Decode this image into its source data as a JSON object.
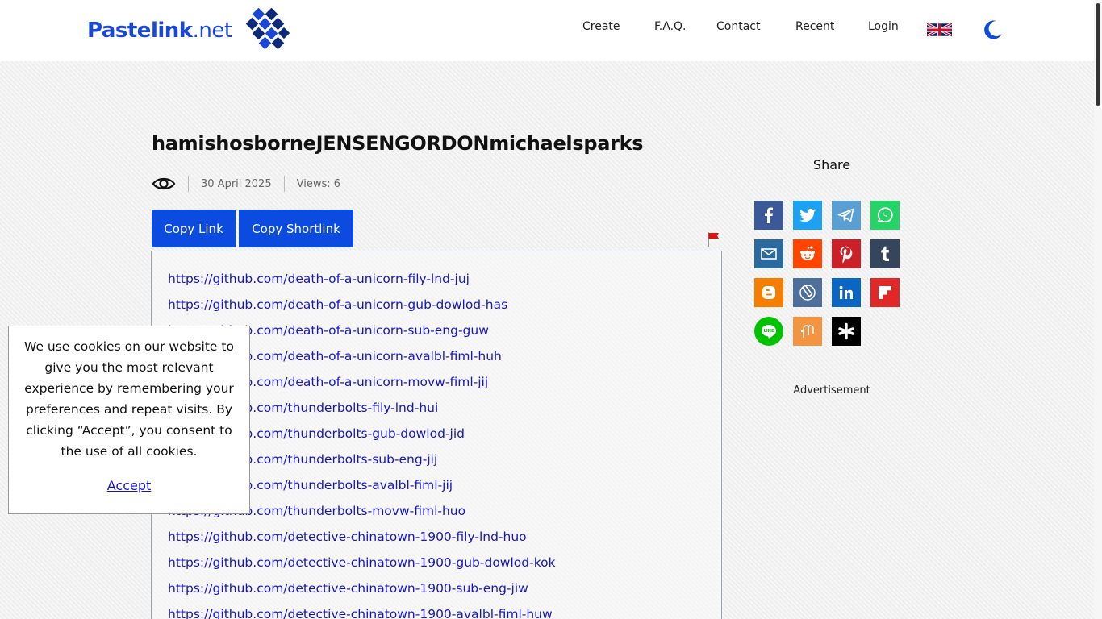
{
  "header": {
    "logo_text_main": "Pastelink",
    "logo_text_suffix": ".net",
    "nav": [
      {
        "label": "Create"
      },
      {
        "label": "F.A.Q."
      },
      {
        "label": "Contact"
      },
      {
        "label": "Recent"
      },
      {
        "label": "Login"
      }
    ],
    "language_icon": "uk-flag-icon",
    "theme_icon": "moon-icon",
    "brand_color": "#1a47d6"
  },
  "paste": {
    "title": "hamishosborneJENSENGORDONmichaelsparks",
    "visibility_icon": "eye-icon",
    "date": "30 April 2025",
    "views": "Views: 6",
    "copy_link_label": "Copy Link",
    "copy_shortlink_label": "Copy Shortlink",
    "report_icon": "red-flag-icon",
    "links": [
      "https://github.com/death-of-a-unicorn-fily-lnd-juj",
      "https://github.com/death-of-a-unicorn-gub-dowlod-has",
      "https://github.com/death-of-a-unicorn-sub-eng-guw",
      "https://github.com/death-of-a-unicorn-avalbl-fiml-huh",
      "https://github.com/death-of-a-unicorn-movw-fiml-jij",
      "https://github.com/thunderbolts-fily-lnd-hui",
      "https://github.com/thunderbolts-gub-dowlod-jid",
      "https://github.com/thunderbolts-sub-eng-jij",
      "https://github.com/thunderbolts-avalbl-fiml-jij",
      "https://github.com/thunderbolts-movw-fiml-huo",
      "https://github.com/detective-chinatown-1900-fily-lnd-huo",
      "https://github.com/detective-chinatown-1900-gub-dowlod-kok",
      "https://github.com/detective-chinatown-1900-sub-eng-jiw",
      "https://github.com/detective-chinatown-1900-avalbl-fiml-huw"
    ],
    "button_color": "#0b4be0",
    "link_color": "#1616c8"
  },
  "sidebar": {
    "share_title": "Share",
    "share_icons": [
      {
        "name": "facebook-icon",
        "color": "#3b5998"
      },
      {
        "name": "twitter-icon",
        "color": "#1da1f2"
      },
      {
        "name": "telegram-icon",
        "color": "#5a9fd4"
      },
      {
        "name": "whatsapp-icon",
        "color": "#25d366"
      },
      {
        "name": "email-icon",
        "color": "#2a6a9e"
      },
      {
        "name": "reddit-icon",
        "color": "#ff4500"
      },
      {
        "name": "pinterest-icon",
        "color": "#cb2027"
      },
      {
        "name": "tumblr-icon",
        "color": "#35465c"
      },
      {
        "name": "blogger-icon",
        "color": "#f57d00"
      },
      {
        "name": "livejournal-icon",
        "color": "#4d6f99"
      },
      {
        "name": "linkedin-icon",
        "color": "#0a66c2"
      },
      {
        "name": "flipboard-icon",
        "color": "#e12828"
      },
      {
        "name": "line-icon",
        "color": "#00c300"
      },
      {
        "name": "mix-icon",
        "color": "#f59440"
      },
      {
        "name": "delicious-icon",
        "color": "#000000"
      }
    ],
    "advertisement_label": "Advertisement"
  },
  "cookie_banner": {
    "text": "We use cookies on our website to give you the most relevant experience by remembering your preferences and repeat visits. By clicking “Accept”, you consent to the use of all cookies.",
    "accept_label": "Accept"
  }
}
